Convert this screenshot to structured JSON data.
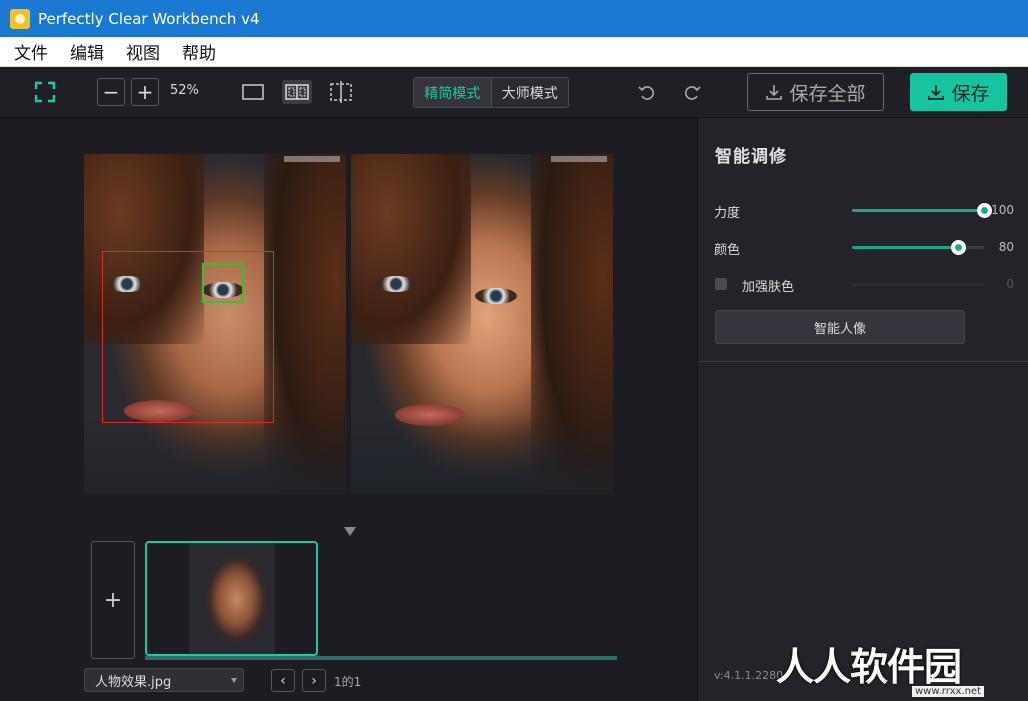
{
  "window": {
    "title": "Perfectly Clear Workbench v4"
  },
  "menu": [
    "文件",
    "编辑",
    "视图",
    "帮助"
  ],
  "toolbar": {
    "zoom_minus": "−",
    "zoom_plus": "+",
    "zoom_value": "52%",
    "mode_simple": "精简模式",
    "mode_master": "大师模式",
    "save_all": "保存全部",
    "save": "保存"
  },
  "panel": {
    "title": "智能调修",
    "strength": {
      "label": "力度",
      "value": "100",
      "fraction": 1.0
    },
    "color": {
      "label": "颜色",
      "value": "80",
      "fraction": 0.8
    },
    "skin": {
      "label": "加强肤色",
      "value": "0",
      "fraction": 0.0
    },
    "smart_portrait": "智能人像",
    "version": "v:4.1.1.2280"
  },
  "filmstrip": {
    "add": "+",
    "file_name": "人物效果.jpg",
    "prev": "‹",
    "next": "›",
    "page_count": "1的1"
  },
  "watermark": {
    "text": "人人软件园",
    "sub": "www.rrxx.net"
  },
  "colors": {
    "accent": "#17c4a0",
    "titlebar": "#1a78d1",
    "panel": "#232329"
  }
}
